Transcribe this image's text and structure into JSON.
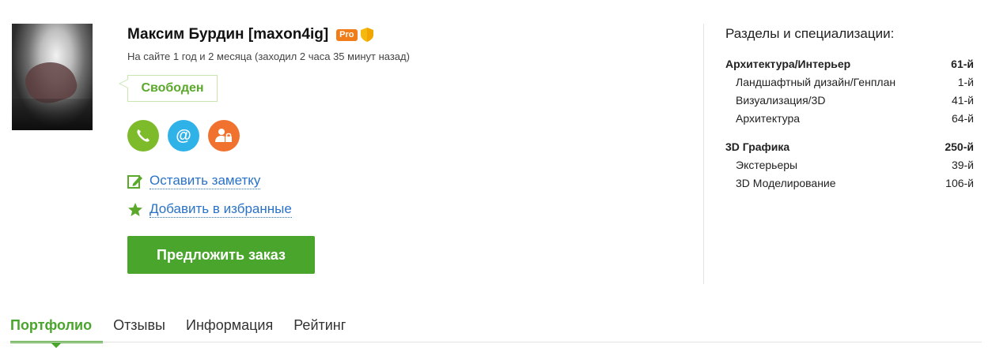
{
  "profile": {
    "name": "Максим Бурдин [maxon4ig]",
    "pro_badge": "Pro",
    "online_status": "На сайте 1 год и 2 месяца (заходил 2 часа 35 минут назад)",
    "availability": "Свободен",
    "contacts": [
      {
        "icon": "phone-icon",
        "glyph": "✆"
      },
      {
        "icon": "email-icon",
        "glyph": "@"
      },
      {
        "icon": "lock-user-icon",
        "glyph": ""
      }
    ],
    "note_link": "Оставить заметку",
    "favorite_link": "Добавить в избранные",
    "offer_button": "Предложить заказ"
  },
  "specializations": {
    "title": "Разделы и специализации:",
    "groups": [
      {
        "name": "Архитектура/Интерьер",
        "rank": "61-й",
        "items": [
          {
            "name": "Ландшафтный дизайн/Генплан",
            "rank": "1-й"
          },
          {
            "name": "Визуализация/3D",
            "rank": "41-й"
          },
          {
            "name": "Архитектура",
            "rank": "64-й"
          }
        ]
      },
      {
        "name": "3D Графика",
        "rank": "250-й",
        "items": [
          {
            "name": "Экстерьеры",
            "rank": "39-й"
          },
          {
            "name": "3D Моделирование",
            "rank": "106-й"
          }
        ]
      }
    ]
  },
  "tabs": [
    {
      "label": "Портфолио",
      "active": true
    },
    {
      "label": "Отзывы",
      "active": false
    },
    {
      "label": "Информация",
      "active": false
    },
    {
      "label": "Рейтинг",
      "active": false
    }
  ],
  "colors": {
    "accent_green": "#4aa52d",
    "link_blue": "#2a72c8",
    "pro_orange": "#f07d1a"
  }
}
